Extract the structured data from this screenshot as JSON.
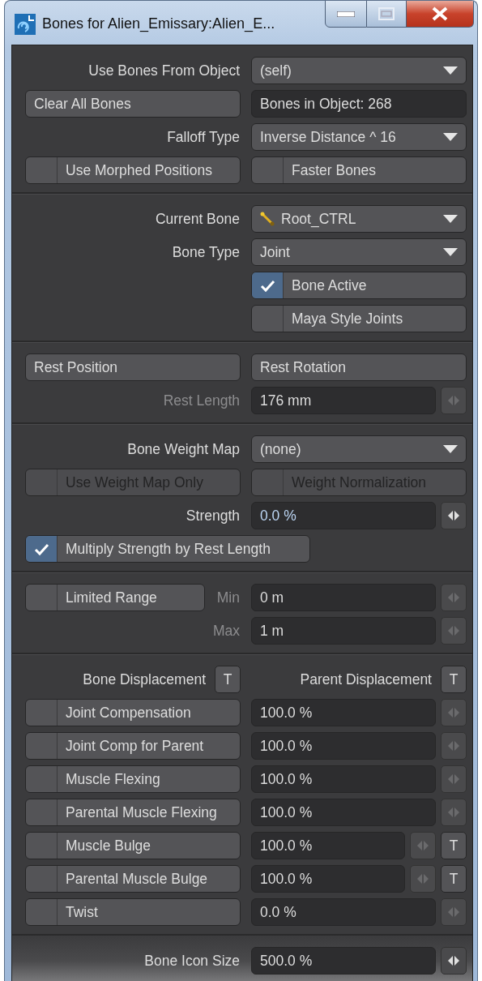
{
  "window": {
    "title": "Bones for Alien_Emissary:Alien_E..."
  },
  "sections": [
    {
      "rows": [
        {
          "kind": "dropdown",
          "label": "Use Bones From Object",
          "value": "(self)"
        },
        {
          "kind": "button_info",
          "button": "Clear All Bones",
          "info": "Bones in Object: 268"
        },
        {
          "kind": "dropdown",
          "label": "Falloff Type",
          "value": "Inverse Distance ^ 16"
        },
        {
          "kind": "checkbox_pair",
          "items": [
            {
              "label": "Use Morphed Positions",
              "checked": false,
              "disabled": false
            },
            {
              "label": "Faster Bones",
              "checked": false,
              "disabled": false
            }
          ]
        }
      ]
    },
    {
      "rows": [
        {
          "kind": "bone_dropdown",
          "label": "Current Bone",
          "value": "Root_CTRL"
        },
        {
          "kind": "dropdown",
          "label": "Bone Type",
          "value": "Joint"
        },
        {
          "kind": "checkbox",
          "label": "Bone Active",
          "checked": true
        },
        {
          "kind": "checkbox",
          "label": "Maya Style Joints",
          "checked": false
        }
      ]
    },
    {
      "rows": [
        {
          "kind": "button_pair",
          "buttons": [
            "Rest Position",
            "Rest Rotation"
          ]
        },
        {
          "kind": "number",
          "label": "Rest Length",
          "value": "176 mm",
          "disabled": true
        }
      ]
    },
    {
      "rows": [
        {
          "kind": "dropdown",
          "label": "Bone Weight Map",
          "value": "(none)"
        },
        {
          "kind": "checkbox_pair",
          "items": [
            {
              "label": "Use Weight Map Only",
              "checked": false,
              "disabled": true
            },
            {
              "label": "Weight Normalization",
              "checked": false,
              "disabled": true
            }
          ]
        },
        {
          "kind": "number",
          "label": "Strength",
          "value": "0.0 %",
          "disabled": false
        },
        {
          "kind": "checkbox_wide",
          "label": "Multiply Strength by Rest Length",
          "checked": true
        }
      ]
    },
    {
      "rows": [
        {
          "kind": "range",
          "checkbox": {
            "label": "Limited Range",
            "checked": false
          },
          "label": "Min",
          "value": "0 m",
          "disabled": true
        },
        {
          "kind": "number",
          "label": "Max",
          "value": "1 m",
          "disabled": true
        }
      ]
    },
    {
      "rows": [
        {
          "kind": "header_pair",
          "items": [
            {
              "label": "Bone Displacement",
              "button": "T"
            },
            {
              "label": "Parent Displacement",
              "button": "T"
            }
          ]
        },
        {
          "kind": "checkbox_number",
          "label": "Joint Compensation",
          "checked": false,
          "value": "100.0 %"
        },
        {
          "kind": "checkbox_number",
          "label": "Joint Comp for Parent",
          "checked": false,
          "value": "100.0 %"
        },
        {
          "kind": "checkbox_number",
          "label": "Muscle Flexing",
          "checked": false,
          "value": "100.0 %"
        },
        {
          "kind": "checkbox_number",
          "label": "Parental Muscle Flexing",
          "checked": false,
          "value": "100.0 %"
        },
        {
          "kind": "checkbox_number",
          "label": "Muscle Bulge",
          "checked": false,
          "value": "100.0 %",
          "button": "T"
        },
        {
          "kind": "checkbox_number",
          "label": "Parental Muscle Bulge",
          "checked": false,
          "value": "100.0 %",
          "button": "T"
        },
        {
          "kind": "checkbox_number",
          "label": "Twist",
          "checked": false,
          "value": "0.0 %"
        }
      ]
    },
    {
      "rows": [
        {
          "kind": "number",
          "label": "Bone Icon Size",
          "value": "500.0 %",
          "disabled": false
        }
      ]
    }
  ]
}
